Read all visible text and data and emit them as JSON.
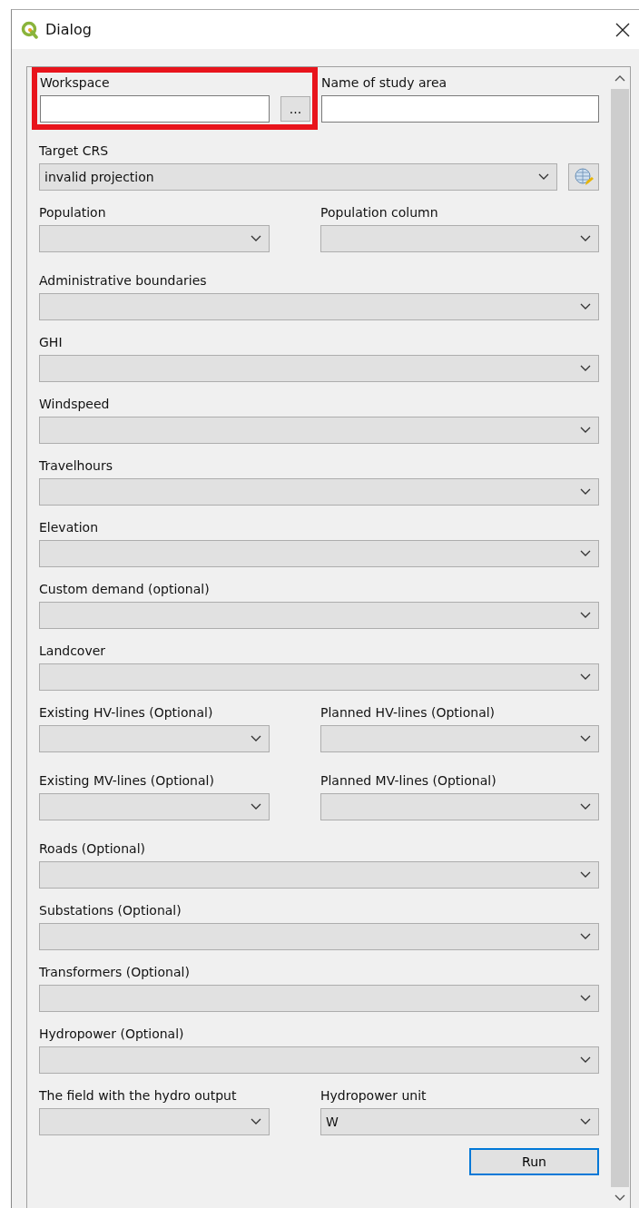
{
  "window": {
    "title": "Dialog"
  },
  "rows": [
    {
      "fields": [
        {
          "label": "Workspace",
          "kind": "text",
          "highlighted": true,
          "browse": "..."
        },
        {
          "label": "Name of study area",
          "kind": "text"
        }
      ]
    },
    {
      "fields": [
        {
          "label": "Target CRS",
          "kind": "crs",
          "value": "invalid projection"
        }
      ]
    },
    {
      "fields": [
        {
          "label": "Population",
          "kind": "combo"
        },
        {
          "label": "Population column",
          "kind": "combo"
        }
      ]
    },
    {
      "fields": [
        {
          "label": "Administrative boundaries",
          "kind": "combo"
        }
      ]
    },
    {
      "fields": [
        {
          "label": "GHI",
          "kind": "combo"
        }
      ]
    },
    {
      "fields": [
        {
          "label": "Windspeed",
          "kind": "combo"
        }
      ]
    },
    {
      "fields": [
        {
          "label": "Travelhours",
          "kind": "combo"
        }
      ]
    },
    {
      "fields": [
        {
          "label": "Elevation",
          "kind": "combo"
        }
      ]
    },
    {
      "fields": [
        {
          "label": "Custom demand (optional)",
          "kind": "combo"
        }
      ]
    },
    {
      "fields": [
        {
          "label": "Landcover",
          "kind": "combo"
        }
      ]
    },
    {
      "fields": [
        {
          "label": "Existing HV-lines (Optional)",
          "kind": "combo"
        },
        {
          "label": "Planned HV-lines (Optional)",
          "kind": "combo"
        }
      ]
    },
    {
      "fields": [
        {
          "label": "Existing MV-lines (Optional)",
          "kind": "combo"
        },
        {
          "label": "Planned MV-lines (Optional)",
          "kind": "combo"
        }
      ]
    },
    {
      "fields": [
        {
          "label": "Roads (Optional)",
          "kind": "combo"
        }
      ]
    },
    {
      "fields": [
        {
          "label": "Substations (Optional)",
          "kind": "combo"
        }
      ]
    },
    {
      "fields": [
        {
          "label": "Transformers (Optional)",
          "kind": "combo"
        }
      ]
    },
    {
      "fields": [
        {
          "label": "Hydropower (Optional)",
          "kind": "combo"
        }
      ]
    },
    {
      "fields": [
        {
          "label": "The field with the hydro output",
          "kind": "combo"
        },
        {
          "label": "Hydropower unit",
          "kind": "combo",
          "value": "W"
        }
      ]
    }
  ],
  "run_button": "Run"
}
